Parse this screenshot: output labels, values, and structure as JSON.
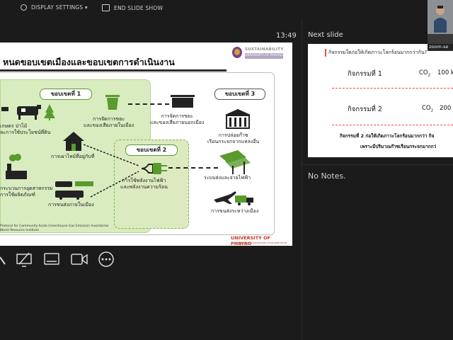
{
  "toolbar": {
    "display_settings": "DISPLAY SETTINGS ▾",
    "end_slide_show": "END SLIDE SHOW"
  },
  "timer": "13:49",
  "slide": {
    "title": "หนดขอบเขตเมืองและขอบเขตการดำเนินงาน",
    "sustain_logo_line1": "SUSTAINABILITY",
    "sustain_logo_line2": "UNIVERSITY OF PHAYAO",
    "scope1_label": "ขอบเขตที่ 1",
    "scope2_label": "ขอบเขตที่ 2",
    "scope3_label": "ขอบเขตที่ 3",
    "labels": {
      "agriculture": "เกษตร ป่าไม้\nละการใช้ประโยชน์ที่ดิน",
      "waste_in": "การจัดการขยะ\nและของเสียภายในเมือง",
      "waste_out": "การจัดการขยะ\nและของเสียภายนอกเมือง",
      "building": "การเผาไหม้ที่อยู่กับที่",
      "industry": "กระบวนการอุตสาหกรรม\nการใช้ผลิตภัณฑ์",
      "transport_in": "การขนส่งภายในเมือง",
      "electricity": "การใช้พลังงานไฟฟ้า\nและพลังงานความร้อน",
      "imports": "การปล่อยก๊าซ\nเรือนกระจกจากแหล่งอื่น",
      "grid": "ระบบส่งและจ่ายไฟฟ้า",
      "transport_out": "การขนส่งระหว่างเมือง"
    },
    "footnote_line1": "Protocol for Community-Scale Greenhouse Gas Emission Inventories",
    "footnote_line2": "World Resource Institute",
    "up_logo": "UNIVERSITY OF PHAYAO",
    "up_sub": "Wisdom for Community Empowerment"
  },
  "right_panel": {
    "next_slide_label": "Next slide",
    "next": {
      "heading": "กิจกรรมใดก่อให้เกิดภาวะโลกร้อนมากกว่ากัน?",
      "row1_label": "กิจกรรมที่ 1",
      "row1_co2": "CO",
      "row1_value": "100 k",
      "row2_label": "กิจกรรมที่ 2",
      "row2_co2": "CO",
      "row2_value": "200",
      "sub": "2",
      "foot1": "กิจกรรมที่ 2 ก่อให้เกิดภาวะโลกร้อนมากกว่า กิจ",
      "foot2": "เพราะมีปริมาณก๊าซเรือนกระจกมากกว่"
    },
    "notes": "No Notes."
  },
  "video": {
    "name": "zoom-se"
  },
  "colors": {
    "accent_green": "#5a9b2e",
    "red_line": "#e74c3c",
    "background": "#1b1b1b"
  }
}
